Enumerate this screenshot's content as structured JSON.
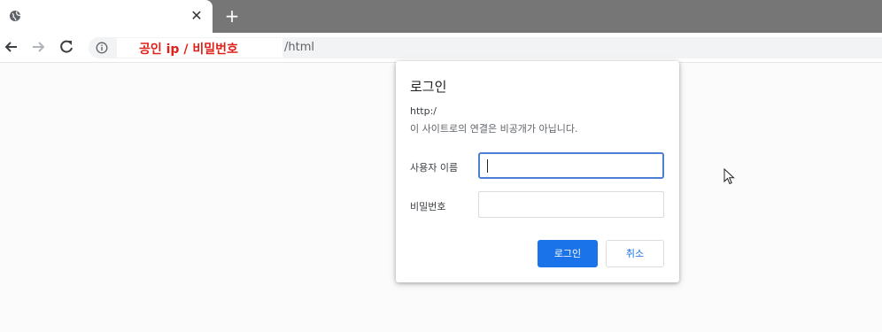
{
  "browser": {
    "tab_close_glyph": "✕",
    "new_tab_glyph": "+",
    "url_annotation": "공인 ip / 비밀번호",
    "url_path": "/html"
  },
  "dialog": {
    "title": "로그인",
    "url": "http:/",
    "notice": "이 사이트로의 연결은 비공개가 아닙니다.",
    "username_label": "사용자 이름",
    "username_value": "",
    "password_label": "비밀번호",
    "password_value": "",
    "login_button": "로그인",
    "cancel_button": "취소"
  },
  "colors": {
    "accent": "#1a73e8",
    "annotation_red": "#e0201b",
    "tabstrip": "#767676"
  },
  "icons": [
    "globe-icon",
    "close-icon",
    "plus-icon",
    "back-arrow-icon",
    "forward-arrow-icon",
    "reload-icon",
    "info-icon",
    "mouse-cursor-icon"
  ]
}
